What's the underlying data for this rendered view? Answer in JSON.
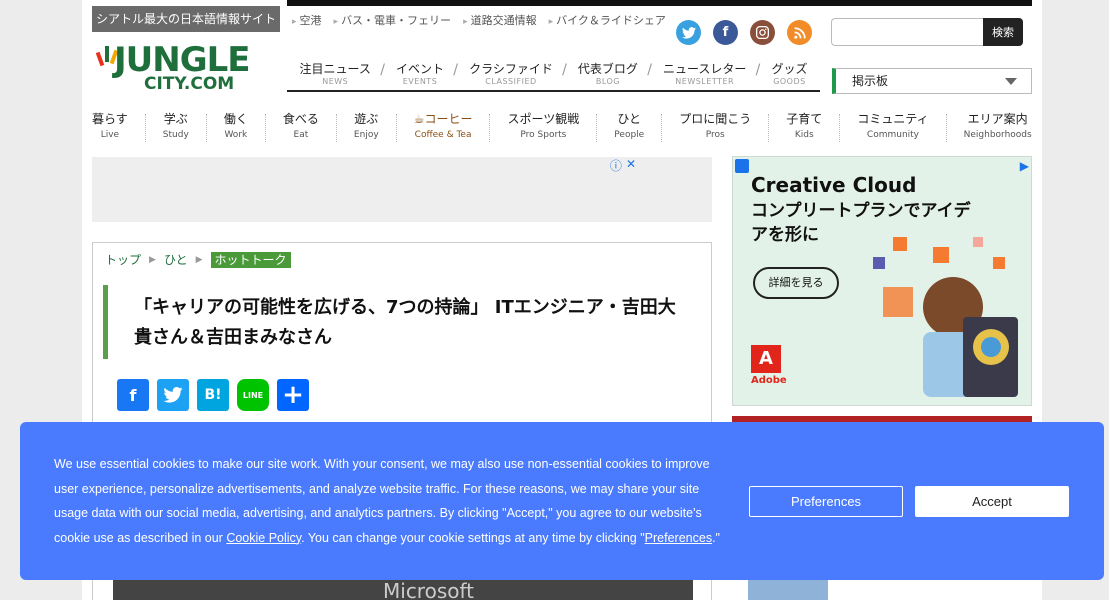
{
  "header": {
    "tagline": "シアトル最大の日本語情報サイト",
    "logo": {
      "line1": "JUNGLE",
      "line2": "CITY.COM"
    },
    "quicklinks": [
      "空港",
      "バス・電車・フェリー",
      "道路交通情報",
      "バイク＆ライドシェア"
    ],
    "mainnav": [
      {
        "jp": "注目ニュース",
        "en": "NEWS"
      },
      {
        "jp": "イベント",
        "en": "EVENTS"
      },
      {
        "jp": "クラシファイド",
        "en": "CLASSIFIED"
      },
      {
        "jp": "代表ブログ",
        "en": "BLOG"
      },
      {
        "jp": "ニュースレター",
        "en": "NEWSLETTER"
      },
      {
        "jp": "グッズ",
        "en": "GOODS"
      }
    ],
    "search": {
      "placeholder": "",
      "button": "検索"
    },
    "board": {
      "label": "掲示板"
    },
    "social_colors": {
      "twitter": "#3aa1e0",
      "facebook": "#3b5998",
      "instagram": "#8a4f3a",
      "rss": "#f28c28"
    }
  },
  "categories": [
    {
      "jp": "暮らす",
      "en": "Live"
    },
    {
      "jp": "学ぶ",
      "en": "Study"
    },
    {
      "jp": "働く",
      "en": "Work"
    },
    {
      "jp": "食べる",
      "en": "Eat"
    },
    {
      "jp": "遊ぶ",
      "en": "Enjoy"
    },
    {
      "jp": "コーヒー",
      "en": "Coffee & Tea"
    },
    {
      "jp": "スポーツ観戦",
      "en": "Pro Sports"
    },
    {
      "jp": "ひと",
      "en": "People"
    },
    {
      "jp": "プロに聞こう",
      "en": "Pros"
    },
    {
      "jp": "子育て",
      "en": "Kids"
    },
    {
      "jp": "コミュニティ",
      "en": "Community"
    },
    {
      "jp": "エリア案内",
      "en": "Neighborhoods"
    }
  ],
  "article": {
    "breadcrumbs": [
      "トップ",
      "ひと",
      "ホットトーク"
    ],
    "title": "「キャリアの可能性を広げる、7つの持論」 ITエンジニア・吉田大貴さん＆吉田まみなさん",
    "share": [
      {
        "name": "facebook",
        "glyph": "f",
        "color": "#1877f2"
      },
      {
        "name": "twitter",
        "glyph": "t",
        "color": "#1da1f2"
      },
      {
        "name": "hatena",
        "glyph": "B!",
        "color": "#00a4de"
      },
      {
        "name": "line",
        "glyph": "LINE",
        "color": "#00c300"
      },
      {
        "name": "share",
        "glyph": "+",
        "color": "#0166ff"
      }
    ],
    "photo_caption": "Microsoft"
  },
  "ad": {
    "headline": "Creative Cloud",
    "body": "コンプリートプランでアイデアを形に",
    "cta": "詳細を見る",
    "brand": "Adobe",
    "brand_color": "#e1251b"
  },
  "cookie": {
    "text_before": "We use essential cookies to make our site work. With your consent, we may also use non-essential cookies to improve user experience, personalize advertisements, and analyze website traffic. For these reasons, we may share your site usage data with our social media, advertising, and analytics partners. By clicking \"Accept,\" you agree to our website's cookie use as described in our ",
    "policy_link": "Cookie Policy",
    "text_middle": ". You can change your cookie settings at any time by clicking \"",
    "preferences_link": "Preferences",
    "text_after": ".\"",
    "preferences_button": "Preferences",
    "accept_button": "Accept",
    "bg_color": "#4a7bff"
  }
}
